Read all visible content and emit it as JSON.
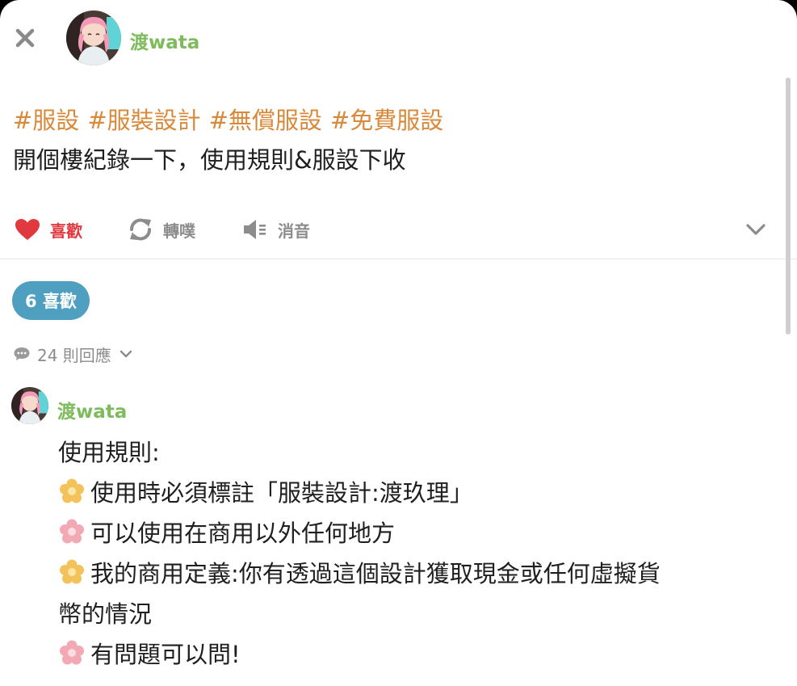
{
  "post": {
    "author": "渡wata",
    "hashtags": [
      "#服設",
      "#服裝設計",
      "#無償服設",
      "#免費服設"
    ],
    "text": "開個樓紀錄一下，使用規則&服設下收"
  },
  "actions": {
    "like_label": "喜歡",
    "repost_label": "轉噗",
    "mute_label": "消音"
  },
  "likes_pill": "6 喜歡",
  "replies_toggle": "24 則回應",
  "comment": {
    "author": "渡wata",
    "lines": [
      "使用規則:",
      "使用時必須標註「服裝設計:渡玖理」",
      "可以使用在商用以外任何地方",
      "我的商用定義:你有透過這個設計獲取現金或任何虛擬貨",
      "幣的情況",
      "有問題可以問!"
    ]
  },
  "colors": {
    "author_green": "#7dbb5d",
    "hashtag_orange": "#d9893a",
    "like_red": "#e0393e",
    "pill_blue": "#4fa0c0",
    "muted_gray": "#8c8c8c",
    "flower_yellow": "#f4c25a",
    "flower_pink": "#f2a9b4"
  },
  "icons": {
    "close": "close-icon",
    "like": "heart-icon",
    "repost": "repost-icon",
    "mute": "speaker-mute-icon",
    "expand": "chevron-down-icon",
    "replies": "comment-bubble-icon",
    "bullet_yellow": "yellow-flower-icon",
    "bullet_pink": "pink-flower-icon"
  }
}
